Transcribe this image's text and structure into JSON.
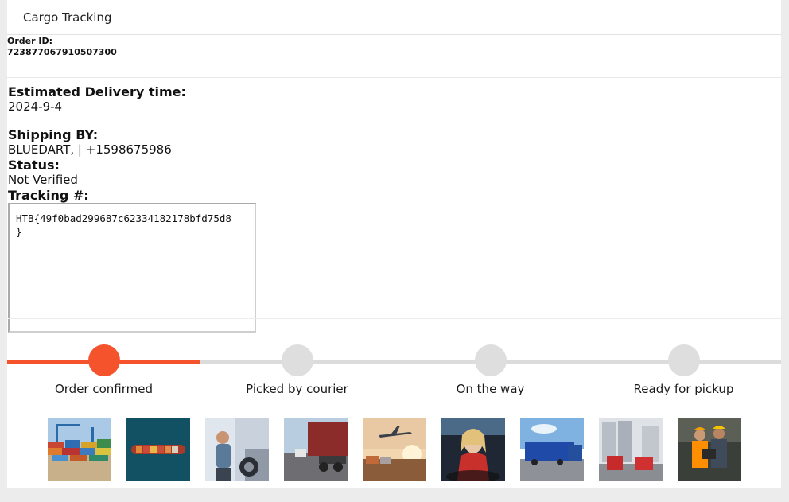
{
  "header": {
    "title": "Cargo Tracking"
  },
  "order": {
    "label": "Order ID:",
    "value": "723877067910507300"
  },
  "delivery": {
    "label": "Estimated Delivery time:",
    "value": "2024-9-4"
  },
  "shipping": {
    "label": "Shipping BY:",
    "value": "BLUEDART, | +1598675986"
  },
  "status": {
    "label": "Status:",
    "value": "Not Verified"
  },
  "tracking": {
    "label": "Tracking #:",
    "value": "HTB{49f0bad299687c62334182178bfd75d8\n}"
  },
  "progress": {
    "completed_fraction": 0.25,
    "steps": [
      {
        "label": "Order confirmed",
        "active": true
      },
      {
        "label": "Picked by courier",
        "active": false
      },
      {
        "label": "On the way",
        "active": false
      },
      {
        "label": "Ready for pickup",
        "active": false
      }
    ],
    "colors": {
      "active": "#f4532c",
      "inactive": "#dedede"
    }
  },
  "gallery": {
    "images": [
      "container-port-image",
      "cargo-ship-aerial-image",
      "truck-driver-image",
      "truck-highway-image",
      "airplane-cargo-image",
      "woman-driver-image",
      "blue-trucks-image",
      "red-truck-silo-image",
      "warehouse-workers-image"
    ]
  }
}
